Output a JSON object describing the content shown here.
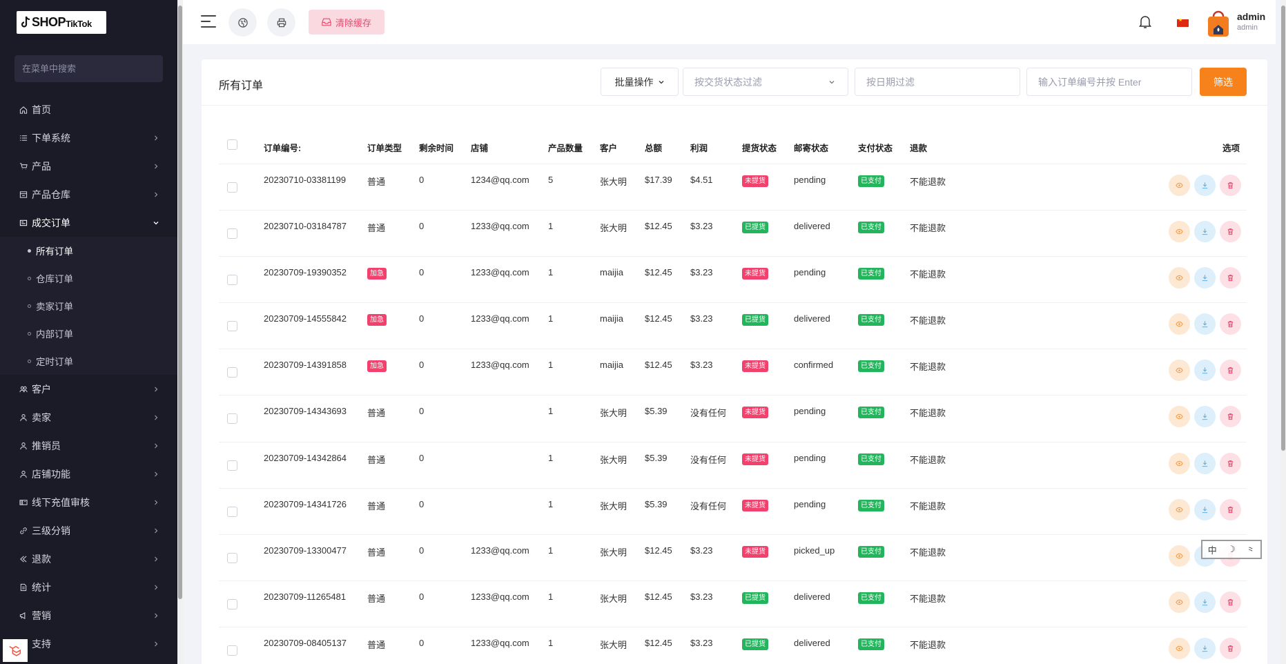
{
  "sidebar": {
    "logo_main": "SHOP",
    "logo_sub": "TikTok",
    "search_placeholder": "在菜单中搜索",
    "items": [
      {
        "label": "首页",
        "icon": "home-icon",
        "chevron": false
      },
      {
        "label": "下单系统",
        "icon": "list-icon",
        "chevron": true
      },
      {
        "label": "产品",
        "icon": "cart-icon",
        "chevron": true
      },
      {
        "label": "产品仓库",
        "icon": "warehouse-icon",
        "chevron": true
      },
      {
        "label": "成交订单",
        "icon": "order-icon",
        "chevron": true,
        "expanded": true
      }
    ],
    "sub_items": [
      "所有订单",
      "仓库订单",
      "卖家订单",
      "内部订单",
      "定时订单"
    ],
    "items_after": [
      {
        "label": "客户",
        "icon": "users-icon"
      },
      {
        "label": "卖家",
        "icon": "user-icon"
      },
      {
        "label": "推销员",
        "icon": "user-icon"
      },
      {
        "label": "店铺功能",
        "icon": "user-icon"
      },
      {
        "label": "线下充值审核",
        "icon": "card-icon"
      },
      {
        "label": "三级分销",
        "icon": "link-icon"
      },
      {
        "label": "退款",
        "icon": "refund-icon"
      },
      {
        "label": "统计",
        "icon": "doc-icon"
      },
      {
        "label": "营销",
        "icon": "megaphone-icon"
      },
      {
        "label": "支持",
        "icon": "support-icon"
      }
    ]
  },
  "topbar": {
    "clear_cache": "清除缓存",
    "user_name": "admin",
    "user_role": "admin"
  },
  "card": {
    "title": "所有订单",
    "batch": "批量操作",
    "status_filter": "按交货状态过滤",
    "date_filter": "按日期过滤",
    "order_search": "输入订单编号并按 Enter",
    "filter_btn": "筛选"
  },
  "table": {
    "headers": [
      "订单编号:",
      "订单类型",
      "剩余时间",
      "店铺",
      "产品数量",
      "客户",
      "总额",
      "利润",
      "提货状态",
      "邮寄状态",
      "支付状态",
      "退款",
      "选项"
    ],
    "rows": [
      {
        "id": "20230710-03381199",
        "type": "普通",
        "urgent": false,
        "time": "0",
        "shop": "1234@qq.com",
        "qty": "5",
        "customer": "张大明",
        "total": "$17.39",
        "profit": "$4.51",
        "pickup": "未提货",
        "pickup_ok": false,
        "mail": "pending",
        "pay": "已支付",
        "refund": "不能退款"
      },
      {
        "id": "20230710-03184787",
        "type": "普通",
        "urgent": false,
        "time": "0",
        "shop": "1233@qq.com",
        "qty": "1",
        "customer": "张大明",
        "total": "$12.45",
        "profit": "$3.23",
        "pickup": "已提货",
        "pickup_ok": true,
        "mail": "delivered",
        "pay": "已支付",
        "refund": "不能退款"
      },
      {
        "id": "20230709-19390352",
        "type": "加急",
        "urgent": true,
        "time": "0",
        "shop": "1233@qq.com",
        "qty": "1",
        "customer": "maijia",
        "total": "$12.45",
        "profit": "$3.23",
        "pickup": "未提货",
        "pickup_ok": false,
        "mail": "pending",
        "pay": "已支付",
        "refund": "不能退款"
      },
      {
        "id": "20230709-14555842",
        "type": "加急",
        "urgent": true,
        "time": "0",
        "shop": "1233@qq.com",
        "qty": "1",
        "customer": "maijia",
        "total": "$12.45",
        "profit": "$3.23",
        "pickup": "已提货",
        "pickup_ok": true,
        "mail": "delivered",
        "pay": "已支付",
        "refund": "不能退款"
      },
      {
        "id": "20230709-14391858",
        "type": "加急",
        "urgent": true,
        "time": "0",
        "shop": "1233@qq.com",
        "qty": "1",
        "customer": "maijia",
        "total": "$12.45",
        "profit": "$3.23",
        "pickup": "未提货",
        "pickup_ok": false,
        "mail": "confirmed",
        "pay": "已支付",
        "refund": "不能退款"
      },
      {
        "id": "20230709-14343693",
        "type": "普通",
        "urgent": false,
        "time": "0",
        "shop": "",
        "qty": "1",
        "customer": "张大明",
        "total": "$5.39",
        "profit": "没有任何",
        "pickup": "未提货",
        "pickup_ok": false,
        "mail": "pending",
        "pay": "已支付",
        "refund": "不能退款"
      },
      {
        "id": "20230709-14342864",
        "type": "普通",
        "urgent": false,
        "time": "0",
        "shop": "",
        "qty": "1",
        "customer": "张大明",
        "total": "$5.39",
        "profit": "没有任何",
        "pickup": "未提货",
        "pickup_ok": false,
        "mail": "pending",
        "pay": "已支付",
        "refund": "不能退款"
      },
      {
        "id": "20230709-14341726",
        "type": "普通",
        "urgent": false,
        "time": "0",
        "shop": "",
        "qty": "1",
        "customer": "张大明",
        "total": "$5.39",
        "profit": "没有任何",
        "pickup": "未提货",
        "pickup_ok": false,
        "mail": "pending",
        "pay": "已支付",
        "refund": "不能退款"
      },
      {
        "id": "20230709-13300477",
        "type": "普通",
        "urgent": false,
        "time": "0",
        "shop": "1233@qq.com",
        "qty": "1",
        "customer": "张大明",
        "total": "$12.45",
        "profit": "$3.23",
        "pickup": "未提货",
        "pickup_ok": false,
        "mail": "picked_up",
        "pay": "已支付",
        "refund": "不能退款"
      },
      {
        "id": "20230709-11265481",
        "type": "普通",
        "urgent": false,
        "time": "0",
        "shop": "1233@qq.com",
        "qty": "1",
        "customer": "张大明",
        "total": "$12.45",
        "profit": "$3.23",
        "pickup": "已提货",
        "pickup_ok": true,
        "mail": "delivered",
        "pay": "已支付",
        "refund": "不能退款"
      },
      {
        "id": "20230709-08405137",
        "type": "普通",
        "urgent": false,
        "time": "0",
        "shop": "1233@qq.com",
        "qty": "1",
        "customer": "张大明",
        "total": "$12.45",
        "profit": "$3.23",
        "pickup": "已提货",
        "pickup_ok": true,
        "mail": "delivered",
        "pay": "已支付",
        "refund": "不能退款"
      }
    ]
  },
  "float_tools": [
    "中",
    "☽",
    "⺀"
  ],
  "colors": {
    "sidebar_bg": "#1b1b28",
    "accent_orange": "#f7821b",
    "badge_red": "#f1416c",
    "badge_green": "#22b55c"
  }
}
